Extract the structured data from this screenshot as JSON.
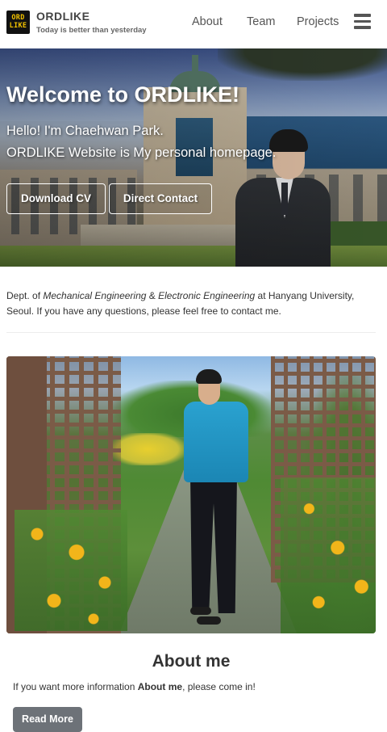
{
  "navbar": {
    "logo_line1": "ORD",
    "logo_line2": "LIKE",
    "brand_name": "ORDLIKE",
    "tagline": "Today is better than yesterday",
    "links": [
      "About",
      "Team",
      "Projects"
    ],
    "menu_icon": "hamburger-menu-icon"
  },
  "hero": {
    "title": "Welcome to ORDLIKE!",
    "line1": "Hello! I'm Chaehwan Park.",
    "line2": "ORDLIKE Website is My personal homepage.",
    "buttons": {
      "download_cv": "Download CV",
      "direct_contact": "Direct Contact"
    }
  },
  "intro": {
    "prefix": "Dept. of ",
    "major1": "Mechanical Engineering",
    "amp": " & ",
    "major2": "Electronic Engineering",
    "suffix": " at Hanyang University, Seoul. If you have any questions, please feel free to contact me."
  },
  "about": {
    "title": "About me",
    "text_prefix": "If you want more information ",
    "text_bold": "About me",
    "text_suffix": ", please come in!",
    "button": "Read More"
  },
  "colors": {
    "logo_background": "#111111",
    "logo_text": "#f2c200",
    "read_more_button": "#6d7278"
  }
}
